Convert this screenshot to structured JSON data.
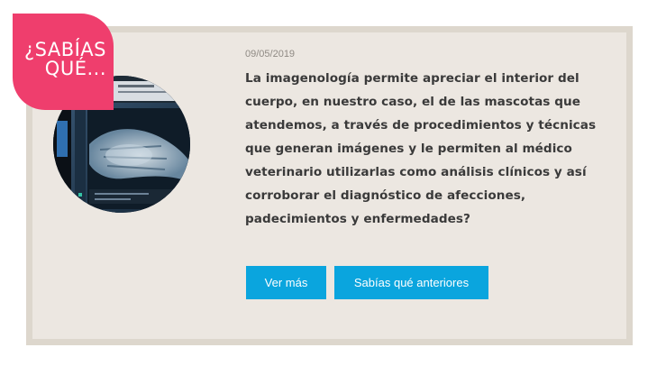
{
  "badge": {
    "line1": "¿SABÍAS",
    "line2": "QUÉ..."
  },
  "article": {
    "date": "09/05/2019",
    "text": "La imagenología permite apreciar el interior del cuerpo, en nuestro caso, el de las mascotas que atendemos, a través de procedimientos y técnicas que generan imágenes y le permiten al médico veterinario utilizarlas como análisis clínicos y así corroborar el diagnóstico de afecciones, padecimientos y enfermedades?"
  },
  "buttons": {
    "more_label": "Ver más",
    "previous_label": "Sabías qué anteriores"
  },
  "colors": {
    "badge": "#ef3e6d",
    "button": "#0aa5de",
    "card_background": "#ece7e1",
    "card_border": "#ddd7cd"
  }
}
